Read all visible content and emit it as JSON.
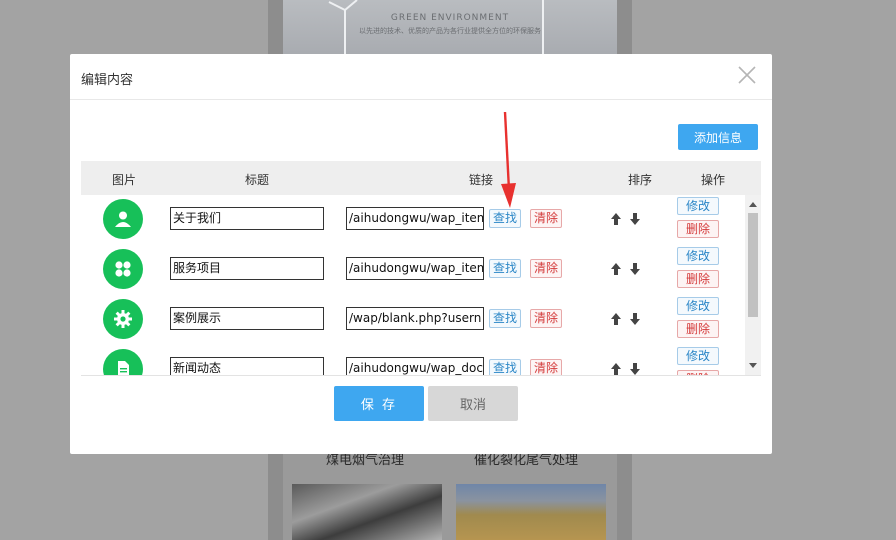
{
  "background": {
    "banner_title": "GREEN ENVIRONMENT",
    "banner_subtitle": "以先进的技术、优质的产品为各行业提供全方位的环保服务",
    "captions": [
      "煤电烟气治理",
      "催化裂化尾气处理"
    ]
  },
  "modal": {
    "title": "编辑内容",
    "close_icon": "close-icon",
    "add_label": "添加信息",
    "headers": {
      "image": "图片",
      "title": "标题",
      "link": "链接",
      "sort": "排序",
      "actions": "操作"
    },
    "rows": [
      {
        "icon": "user-icon",
        "title": "关于我们",
        "link": "/aihudongwu/wap_item"
      },
      {
        "icon": "grid-icon",
        "title": "服务项目",
        "link": "/aihudongwu/wap_item"
      },
      {
        "icon": "gear-icon",
        "title": "案例展示",
        "link": "/wap/blank.php?usern"
      },
      {
        "icon": "document-icon",
        "title": "新闻动态",
        "link": "/aihudongwu/wap_doc"
      }
    ],
    "row_buttons": {
      "find": "查找",
      "clear": "清除",
      "edit": "修改",
      "delete": "删除"
    },
    "save_label": "保 存",
    "cancel_label": "取消"
  },
  "colors": {
    "accent": "#3ea7f0",
    "icon_green": "#17c059",
    "danger": "#d43b3b",
    "annotation_red": "#e8312f"
  }
}
